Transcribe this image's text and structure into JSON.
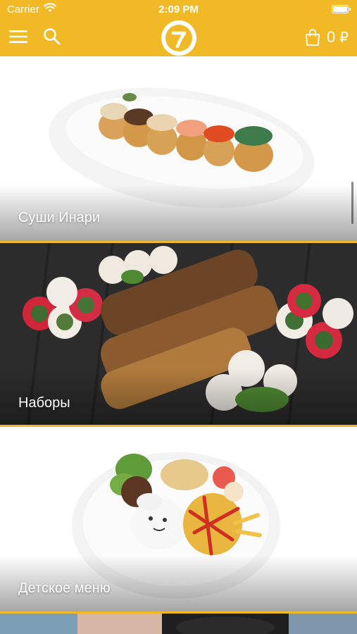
{
  "status_bar": {
    "carrier": "Carrier",
    "time": "2:09 PM",
    "icons": [
      "wifi-icon",
      "battery-icon"
    ]
  },
  "navbar": {
    "background_color": "#f1b926",
    "icons": [
      "menu-icon",
      "search-icon",
      "logo",
      "shopping-bag-icon"
    ],
    "cart": {
      "count": "0",
      "currency": "₽"
    }
  },
  "categories": [
    {
      "label": "Суши Инари"
    },
    {
      "label": "Наборы"
    },
    {
      "label": "Детское меню"
    },
    {
      "label": ""
    }
  ]
}
